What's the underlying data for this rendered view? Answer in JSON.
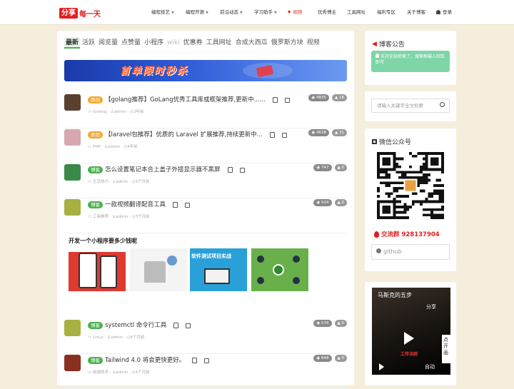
{
  "header": {
    "logo_box": "分享",
    "logo_text": "每一天",
    "nav": [
      {
        "label": "编程技艺",
        "dropdown": true
      },
      {
        "label": "编程开源",
        "dropdown": true
      },
      {
        "label": "前沿动态",
        "dropdown": true
      },
      {
        "label": "学习助手",
        "dropdown": true
      },
      {
        "label": "视频",
        "dropdown": false,
        "active": true
      },
      {
        "label": "优秀博主",
        "dropdown": false
      },
      {
        "label": "工具网址",
        "dropdown": false
      },
      {
        "label": "福利专区",
        "dropdown": false
      },
      {
        "label": "关于博客",
        "dropdown": false
      },
      {
        "label": "登录",
        "dropdown": false
      }
    ]
  },
  "tabs": [
    "最新",
    "活跃",
    "阅览量",
    "点赞量",
    "小程序",
    "wiki",
    "优惠券",
    "工具网址",
    "合成大西瓜",
    "俄罗斯方块",
    "视频"
  ],
  "banner": {
    "text": "首单限时秒杀"
  },
  "posts": [
    {
      "tag": "原创",
      "tag_type": "orig",
      "title": "【golang推荐】GoLang优秀工具库或框架推荐,更新中......",
      "category": "Golang",
      "author": "admin",
      "time": "3年前",
      "views": "4835",
      "likes": "18",
      "avatar_color": "#5a4030"
    },
    {
      "tag": "原创",
      "tag_type": "orig",
      "title": "【laravel包推荐】优质的 Laravel 扩展推荐,持续更新中...",
      "category": "PHP",
      "author": "admin",
      "time": "4年前",
      "views": "4638",
      "likes": "31",
      "avatar_color": "#d8a8b0"
    },
    {
      "tag": "博客",
      "tag_type": "blog",
      "title": "怎么设置笔记本合上盖子外接显示器不黑屏",
      "category": "生活技巧",
      "author": "admin",
      "time": "3个月前",
      "views": "747",
      "likes": "0",
      "avatar_color": "#3a8a4a"
    },
    {
      "tag": "博客",
      "tag_type": "blog",
      "title": "一款视频翻译配音工具",
      "category": "工具推荐",
      "author": "admin",
      "time": "3个月前",
      "views": "504",
      "likes": "0",
      "avatar_color": "#a8b040"
    },
    {
      "tag": "博客",
      "tag_type": "blog",
      "title": "systemctl 命令行工具",
      "category": "Linux",
      "author": "admin",
      "time": "4个月前",
      "views": "578",
      "likes": "0",
      "avatar_color": "#a8b040"
    },
    {
      "tag": "博客",
      "tag_type": "blog",
      "title": "Tailwind 4.0 将会更快更好。",
      "category": "前端技术",
      "author": "admin",
      "time": "4个月前",
      "views": "648",
      "likes": "0",
      "avatar_color": "#8a3020"
    }
  ],
  "ad": {
    "title": "开发一个小程序要多少钱呢",
    "img3_text": "软件测试项目实战"
  },
  "sidebar": {
    "notice_title": "博客公告",
    "notice_text": "支持全站检索了，搜索框输入回车即可",
    "search_placeholder": "请输入关键字全文检索",
    "wechat_title": "微信公众号",
    "group_label": "交流群 928137904",
    "github_label": "github",
    "video_title": "马斯克的五步",
    "video_sub": "工作法则",
    "video_side": "点开画",
    "video_auto": "自动",
    "video_share": "分享"
  }
}
